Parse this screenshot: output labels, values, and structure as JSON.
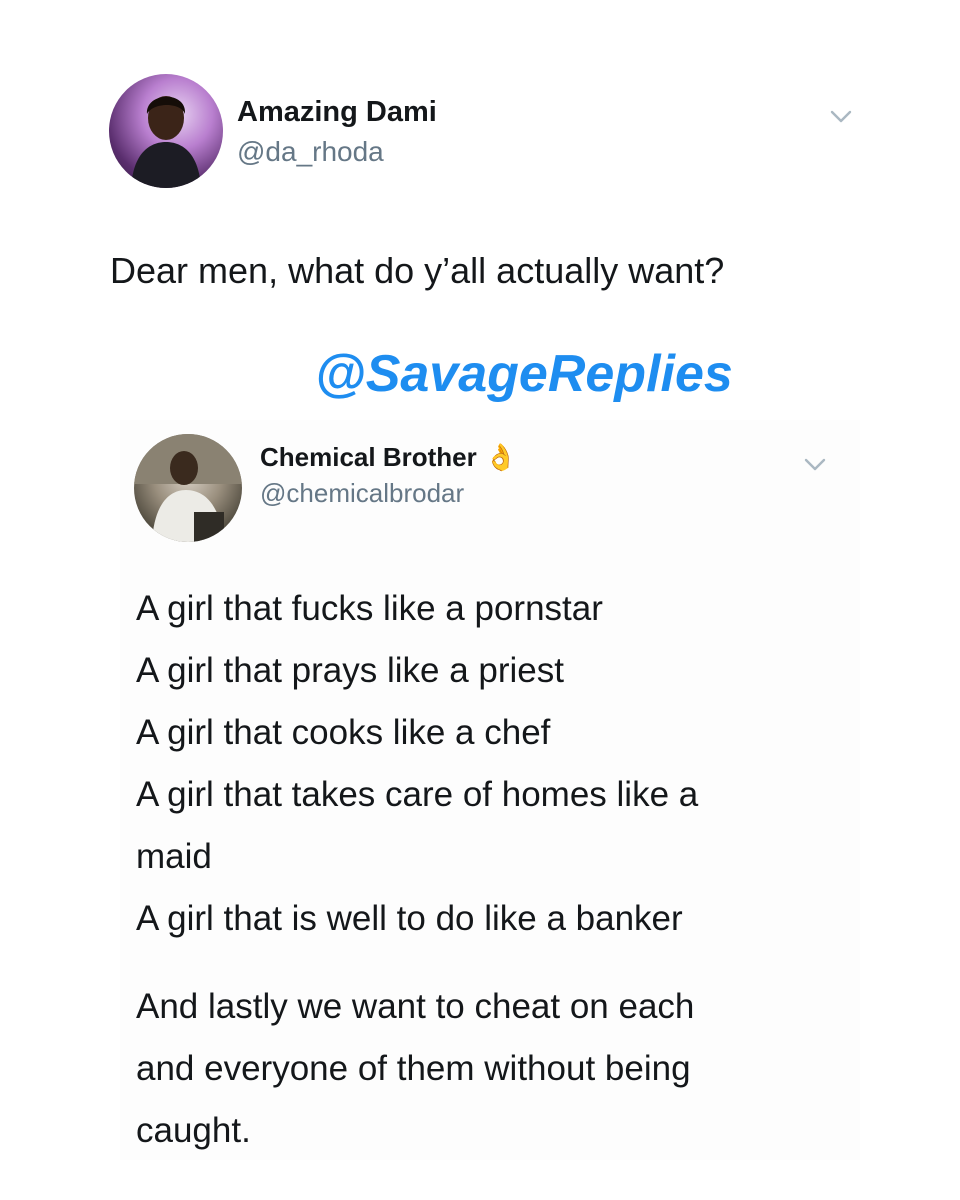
{
  "original_tweet": {
    "display_name": "Amazing Dami",
    "handle": "@da_rhoda",
    "text": "Dear men, what do y’all actually want?",
    "avatar_icon": "profile-photo",
    "menu_icon": "chevron-down-icon"
  },
  "watermark": {
    "text": "@SavageReplies",
    "color": "#1e8df0"
  },
  "reply_tweet": {
    "display_name": "Chemical Brother",
    "emoji": "👌",
    "handle": "@chemicalbrodar",
    "avatar_icon": "profile-photo",
    "menu_icon": "chevron-down-icon",
    "lines": [
      "A girl that fucks like a pornstar",
      "A girl that prays like a priest",
      "A girl that cooks like a chef",
      "A girl that takes care of homes like a",
      "maid",
      "A girl that is well to do like a banker"
    ],
    "closing_lines": [
      "And lastly we want to cheat on each",
      "and everyone of them without being",
      "caught."
    ]
  },
  "colors": {
    "name": "#14171a",
    "handle": "#657786",
    "chevron": "#aab8c2"
  }
}
